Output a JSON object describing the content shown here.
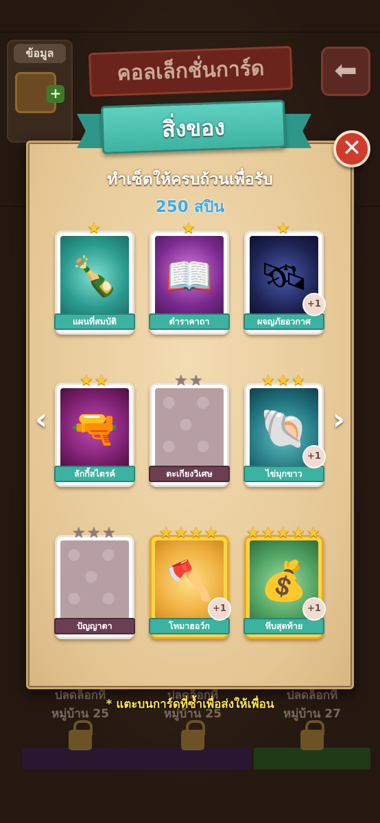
{
  "background": {
    "info_label": "ข้อมูล",
    "collection_title": "คอลเล็กชั่นการ์ด",
    "villages": [
      {
        "line1": "ปลดล็อกที่",
        "line2": "หมู่บ้าน 25"
      },
      {
        "line1": "ปลดล็อกที่",
        "line2": "หมู่บ้าน 25"
      },
      {
        "line1": "ปลดล็อกที่",
        "line2": "หมู่บ้าน 27"
      }
    ]
  },
  "panel": {
    "title": "สิ่งของ",
    "subtitle": "ทำเซ็ตให้ครบถ้วนเพื่อรับ",
    "reward": "250 สปิน",
    "footer_note": "* แตะบนการ์ดที่ซ้ำเพื่อส่งให้เพื่อน"
  },
  "cards": [
    {
      "name": "แผนที่สมบัติ",
      "stars": 1,
      "owned": true,
      "extra": null
    },
    {
      "name": "ตำราคาถา",
      "stars": 1,
      "owned": true,
      "extra": null
    },
    {
      "name": "ผจญภัยอวกาศ",
      "stars": 1,
      "owned": true,
      "extra": "+1"
    },
    {
      "name": "ลักกี้สไตรค์",
      "stars": 2,
      "owned": true,
      "extra": null
    },
    {
      "name": "ตะเกียงวิเศษ",
      "stars": 2,
      "owned": false,
      "extra": null
    },
    {
      "name": "ไข่มุกขาว",
      "stars": 3,
      "owned": true,
      "extra": "+1"
    },
    {
      "name": "ปัญญาตา",
      "stars": 3,
      "owned": false,
      "extra": null
    },
    {
      "name": "โทมาฮอว์ก",
      "stars": 4,
      "owned": true,
      "extra": "+1",
      "gold": true
    },
    {
      "name": "หีบสุดท้าย",
      "stars": 5,
      "owned": true,
      "extra": "+1",
      "gold": true
    }
  ],
  "colors": {
    "ribbon": "#3fb3a2",
    "close": "#d23a2c",
    "reward": "#3fa9e8",
    "footer": "#ffe54a",
    "star": "#ffc928"
  },
  "icons": {
    "close": "close-icon",
    "prev": "chevron-left-icon",
    "next": "chevron-right-icon",
    "back": "back-arrow-icon",
    "star": "star-icon"
  }
}
